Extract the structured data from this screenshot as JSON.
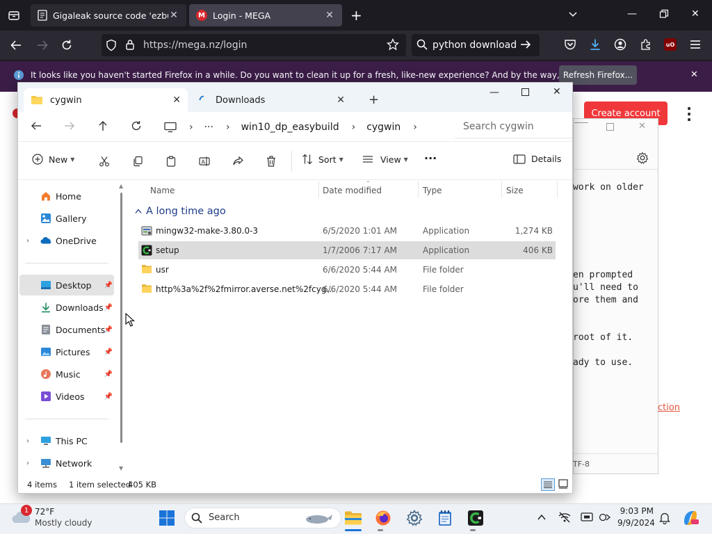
{
  "firefox": {
    "tabs": [
      {
        "label": "Gigaleak source code 'ezbuild",
        "favicon": "document-icon",
        "active": false
      },
      {
        "label": "Login - MEGA",
        "favicon": "mega-logo",
        "active": true
      }
    ],
    "url": "https://mega.nz/login",
    "search_text": "python download",
    "notice_text": "It looks like you haven't started Firefox in a while. Do you want to clean it up for a fresh, like-new experience? And by the way, welcome back!",
    "notice_button": "Refresh Firefox...",
    "ublock_badge": "uO"
  },
  "page": {
    "create_account": "Create account",
    "notepad_lines": [
      "work on older",
      "en prompted",
      "u'll need to",
      "ore them and",
      "root of it.",
      "ady to use."
    ],
    "link_text": "ction",
    "encoding": "TF-8"
  },
  "explorer": {
    "tabs": [
      {
        "label": "cygwin",
        "icon": "folder-icon",
        "active": true
      },
      {
        "label": "Downloads",
        "icon": "loading-icon",
        "active": false
      }
    ],
    "breadcrumb": {
      "ellipsis": "···",
      "segments": [
        "win10_dp_easybuild",
        "cygwin"
      ]
    },
    "search_placeholder": "Search cygwin",
    "commands": {
      "new": "New",
      "sort": "Sort",
      "view": "View",
      "more": "···",
      "details": "Details"
    },
    "nav": {
      "home": "Home",
      "gallery": "Gallery",
      "onedrive": "OneDrive",
      "desktop": "Desktop",
      "downloads": "Downloads",
      "documents": "Documents",
      "pictures": "Pictures",
      "music": "Music",
      "videos": "Videos",
      "this_pc": "This PC",
      "network": "Network"
    },
    "columns": {
      "name": "Name",
      "date": "Date modified",
      "type": "Type",
      "size": "Size"
    },
    "group": "A long time ago",
    "files": [
      {
        "name": "mingw32-make-3.80.0-3",
        "date": "6/5/2020 1:01 AM",
        "type": "Application",
        "size": "1,274 KB",
        "icon": "installer-icon",
        "selected": false
      },
      {
        "name": "setup",
        "date": "1/7/2006 7:17 AM",
        "type": "Application",
        "size": "406 KB",
        "icon": "cygwin-setup-icon",
        "selected": true
      },
      {
        "name": "usr",
        "date": "6/6/2020 5:44 AM",
        "type": "File folder",
        "size": "",
        "icon": "folder-icon",
        "selected": false
      },
      {
        "name": "http%3a%2f%2fmirror.averse.net%2fcyg...",
        "date": "6/6/2020 5:44 AM",
        "type": "File folder",
        "size": "",
        "icon": "folder-icon",
        "selected": false
      }
    ],
    "status": {
      "count": "4 items",
      "selection": "1 item selected",
      "size": "405 KB"
    }
  },
  "taskbar": {
    "weather_badge": "1",
    "temp": "72°F",
    "condition": "Mostly cloudy",
    "search": "Search",
    "time": "9:03 PM",
    "date": "9/9/2024"
  }
}
